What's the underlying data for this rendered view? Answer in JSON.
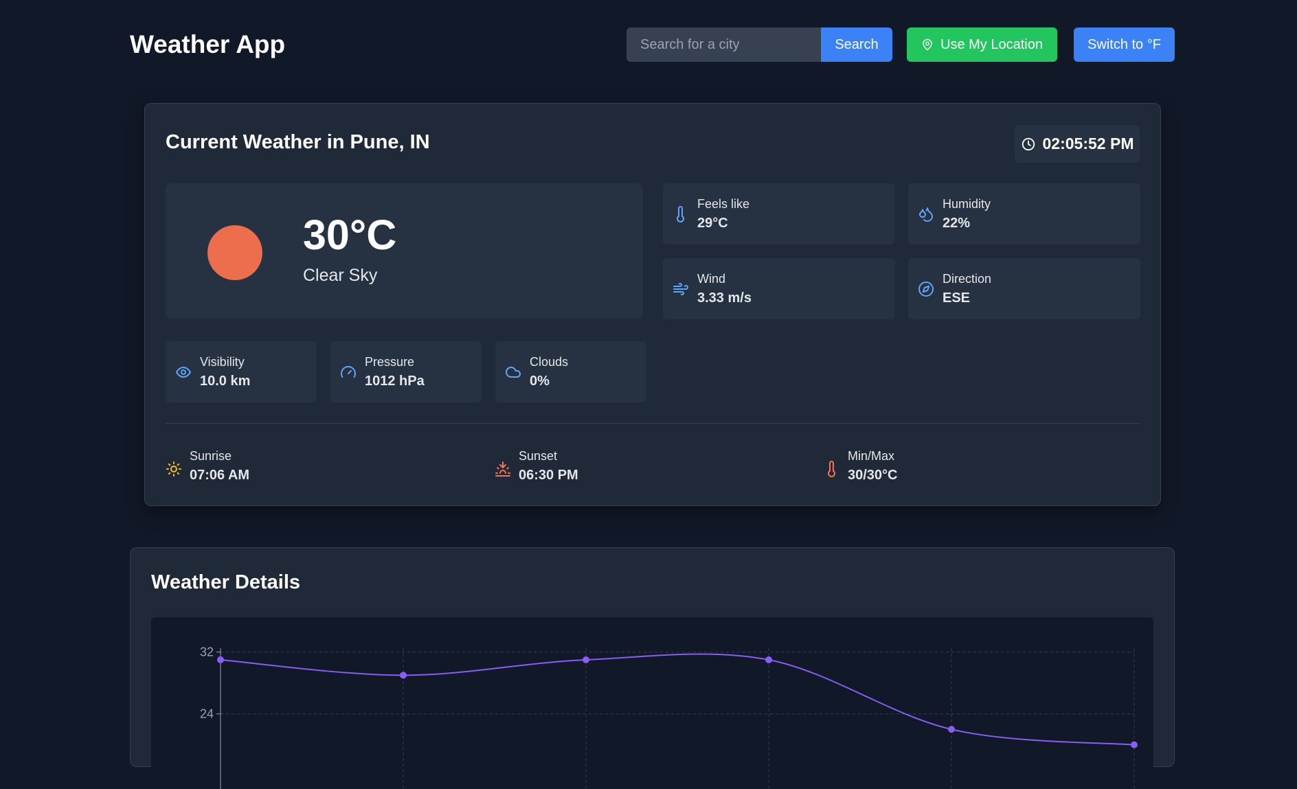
{
  "header": {
    "title": "Weather App",
    "search_placeholder": "Search for a city",
    "search_label": "Search",
    "location_label": "Use My Location",
    "unit_label": "Switch to °F"
  },
  "current": {
    "title": "Current Weather in Pune, IN",
    "time": "02:05:52 PM",
    "temperature": "30°C",
    "description": "Clear Sky",
    "icon": "sun-icon",
    "stats": {
      "feels_like": {
        "label": "Feels like",
        "value": "29°C",
        "icon": "thermometer-icon"
      },
      "humidity": {
        "label": "Humidity",
        "value": "22%",
        "icon": "droplets-icon"
      },
      "wind": {
        "label": "Wind",
        "value": "3.33 m/s",
        "icon": "wind-icon"
      },
      "direction": {
        "label": "Direction",
        "value": "ESE",
        "icon": "compass-icon"
      },
      "visibility": {
        "label": "Visibility",
        "value": "10.0 km",
        "icon": "eye-icon"
      },
      "pressure": {
        "label": "Pressure",
        "value": "1012 hPa",
        "icon": "gauge-icon"
      },
      "clouds": {
        "label": "Clouds",
        "value": "0%",
        "icon": "cloud-icon"
      }
    },
    "sunrise": {
      "label": "Sunrise",
      "value": "07:06 AM",
      "icon": "sunrise-icon"
    },
    "sunset": {
      "label": "Sunset",
      "value": "06:30 PM",
      "icon": "sunset-icon"
    },
    "minmax": {
      "label": "Min/Max",
      "value": "30/30°C",
      "icon": "thermometer-icon"
    }
  },
  "details": {
    "title": "Weather Details"
  },
  "colors": {
    "accent_blue": "#3b82f6",
    "accent_green": "#22c55e",
    "sun": "#ec6e4c",
    "line": "#8b5cf6",
    "icon_blue": "#60a5fa",
    "sunrise": "#fbbf24",
    "sunset_red": "#f97352"
  },
  "chart_data": {
    "type": "line",
    "x_count": 6,
    "values": [
      31,
      29,
      31,
      31,
      22,
      20
    ],
    "yticks": [
      24,
      32
    ],
    "ylim": [
      16,
      32.5
    ],
    "grid": true
  }
}
